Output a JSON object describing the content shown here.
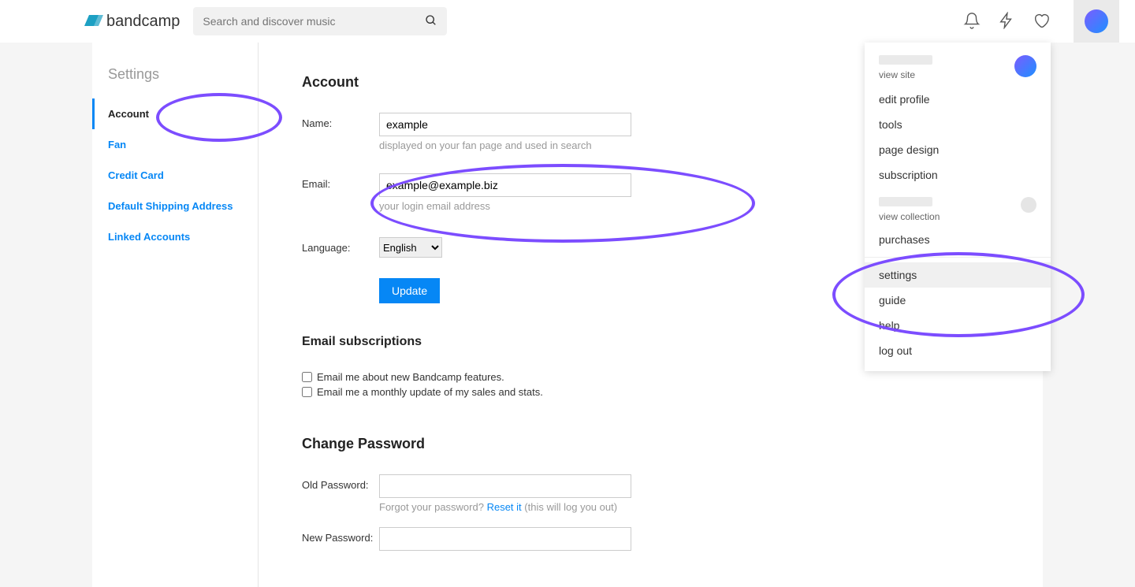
{
  "header": {
    "logo_text": "bandcamp",
    "search_placeholder": "Search and discover music"
  },
  "sidebar": {
    "title": "Settings",
    "items": [
      {
        "label": "Account",
        "active": true
      },
      {
        "label": "Fan",
        "active": false
      },
      {
        "label": "Credit Card",
        "active": false
      },
      {
        "label": "Default Shipping Address",
        "active": false
      },
      {
        "label": "Linked Accounts",
        "active": false
      }
    ]
  },
  "account": {
    "heading": "Account",
    "name_label": "Name:",
    "name_value": "example",
    "name_hint": "displayed on your fan page and used in search",
    "email_label": "Email:",
    "email_value": "example@example.biz",
    "email_hint": "your login email address",
    "language_label": "Language:",
    "language_value": "English",
    "update_label": "Update"
  },
  "email_subs": {
    "heading": "Email subscriptions",
    "opt1": "Email me about new Bandcamp features.",
    "opt2": "Email me a monthly update of my sales and stats."
  },
  "password": {
    "heading": "Change Password",
    "old_label": "Old Password:",
    "forgot_text": "Forgot your password? ",
    "reset_link": "Reset it",
    "reset_suffix": " (this will log you out)",
    "new_label": "New Password:"
  },
  "dropdown": {
    "view_site": "view site",
    "items1": [
      "edit profile",
      "tools",
      "page design",
      "subscription"
    ],
    "view_collection": "view collection",
    "items2": [
      "purchases"
    ],
    "items3": [
      "settings",
      "guide",
      "help",
      "log out"
    ]
  }
}
